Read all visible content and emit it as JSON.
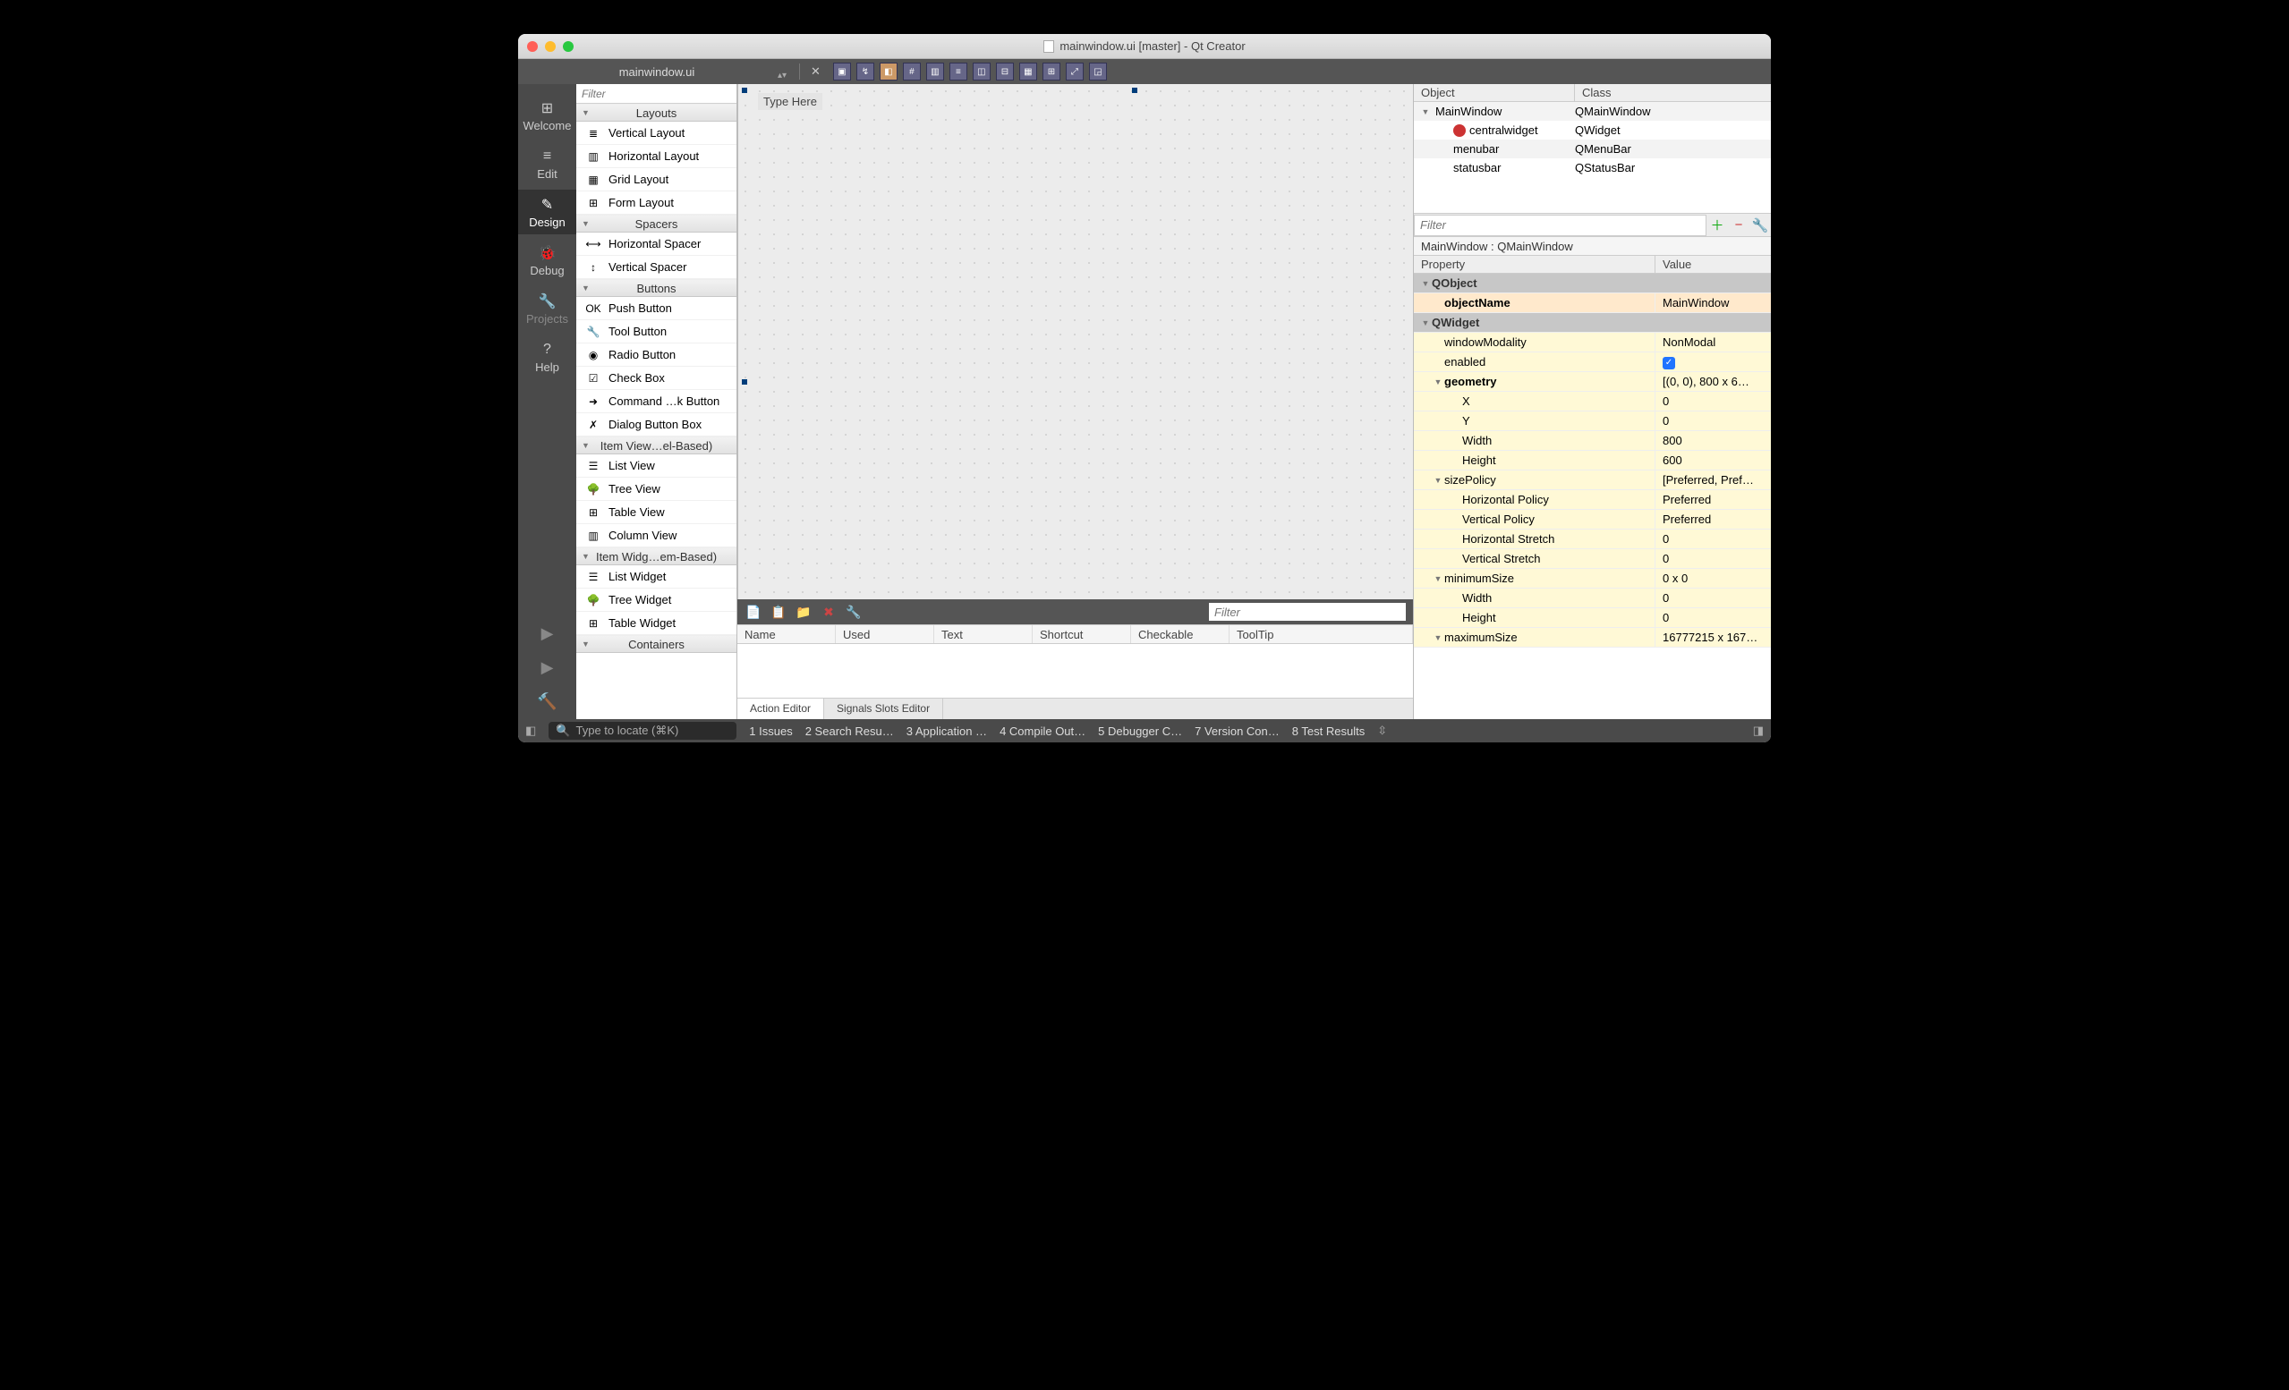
{
  "window": {
    "title": "mainwindow.ui [master] - Qt Creator"
  },
  "subbar": {
    "file": "mainwindow.ui"
  },
  "leftnav": {
    "items": [
      {
        "label": "Welcome",
        "icon": "⊞"
      },
      {
        "label": "Edit",
        "icon": "≡"
      },
      {
        "label": "Design",
        "icon": "✎",
        "active": true
      },
      {
        "label": "Debug",
        "icon": "🐞"
      },
      {
        "label": "Projects",
        "icon": "🔧",
        "dim": true
      },
      {
        "label": "Help",
        "icon": "?"
      }
    ]
  },
  "widgetbox": {
    "filter_placeholder": "Filter",
    "groups": [
      {
        "title": "Layouts",
        "items": [
          {
            "label": "Vertical Layout"
          },
          {
            "label": "Horizontal Layout"
          },
          {
            "label": "Grid Layout"
          },
          {
            "label": "Form Layout"
          }
        ]
      },
      {
        "title": "Spacers",
        "items": [
          {
            "label": "Horizontal Spacer"
          },
          {
            "label": "Vertical Spacer"
          }
        ]
      },
      {
        "title": "Buttons",
        "items": [
          {
            "label": "Push Button"
          },
          {
            "label": "Tool Button"
          },
          {
            "label": "Radio Button"
          },
          {
            "label": "Check Box"
          },
          {
            "label": "Command …k Button"
          },
          {
            "label": "Dialog Button Box"
          }
        ]
      },
      {
        "title": "Item View…el-Based)",
        "items": [
          {
            "label": "List View"
          },
          {
            "label": "Tree View"
          },
          {
            "label": "Table View"
          },
          {
            "label": "Column View"
          }
        ]
      },
      {
        "title": "Item Widg…em-Based)",
        "items": [
          {
            "label": "List Widget"
          },
          {
            "label": "Tree Widget"
          },
          {
            "label": "Table Widget"
          }
        ]
      },
      {
        "title": "Containers",
        "items": []
      }
    ]
  },
  "canvas": {
    "typehere": "Type Here"
  },
  "action_editor": {
    "filter_placeholder": "Filter",
    "cols": {
      "name": "Name",
      "used": "Used",
      "text": "Text",
      "shortcut": "Shortcut",
      "checkable": "Checkable",
      "tooltip": "ToolTip"
    },
    "tabs": {
      "action": "Action Editor",
      "signals": "Signals  Slots Editor"
    }
  },
  "object_inspector": {
    "head": {
      "object": "Object",
      "class": "Class"
    },
    "rows": [
      {
        "name": "MainWindow",
        "class": "QMainWindow",
        "indent": 0,
        "expand": true
      },
      {
        "name": "centralwidget",
        "class": "QWidget",
        "indent": 1,
        "badge": true
      },
      {
        "name": "menubar",
        "class": "QMenuBar",
        "indent": 1
      },
      {
        "name": "statusbar",
        "class": "QStatusBar",
        "indent": 1
      }
    ]
  },
  "properties": {
    "filter_placeholder": "Filter",
    "title": "MainWindow : QMainWindow",
    "head": {
      "prop": "Property",
      "val": "Value"
    },
    "rows": [
      {
        "type": "section",
        "label": "QObject"
      },
      {
        "type": "prop",
        "label": "objectName",
        "value": "MainWindow",
        "bold": true,
        "cls": "or"
      },
      {
        "type": "section",
        "label": "QWidget"
      },
      {
        "type": "prop",
        "label": "windowModality",
        "value": "NonModal",
        "cls": "yl"
      },
      {
        "type": "prop",
        "label": "enabled",
        "value": "__check__",
        "cls": "yl"
      },
      {
        "type": "group",
        "label": "geometry",
        "value": "[(0, 0), 800 x 6…",
        "cls": "yl",
        "bold": true
      },
      {
        "type": "sub",
        "label": "X",
        "value": "0",
        "cls": "yl"
      },
      {
        "type": "sub",
        "label": "Y",
        "value": "0",
        "cls": "yl"
      },
      {
        "type": "sub",
        "label": "Width",
        "value": "800",
        "cls": "yl"
      },
      {
        "type": "sub",
        "label": "Height",
        "value": "600",
        "cls": "yl"
      },
      {
        "type": "group",
        "label": "sizePolicy",
        "value": "[Preferred, Pref…",
        "cls": "yl"
      },
      {
        "type": "sub",
        "label": "Horizontal Policy",
        "value": "Preferred",
        "cls": "yl"
      },
      {
        "type": "sub",
        "label": "Vertical Policy",
        "value": "Preferred",
        "cls": "yl"
      },
      {
        "type": "sub",
        "label": "Horizontal Stretch",
        "value": "0",
        "cls": "yl"
      },
      {
        "type": "sub",
        "label": "Vertical Stretch",
        "value": "0",
        "cls": "yl"
      },
      {
        "type": "group",
        "label": "minimumSize",
        "value": "0 x 0",
        "cls": "yl"
      },
      {
        "type": "sub",
        "label": "Width",
        "value": "0",
        "cls": "yl"
      },
      {
        "type": "sub",
        "label": "Height",
        "value": "0",
        "cls": "yl"
      },
      {
        "type": "group",
        "label": "maximumSize",
        "value": "16777215 x 167…",
        "cls": "yl"
      }
    ]
  },
  "statusbar": {
    "locate_placeholder": "Type to locate (⌘K)",
    "items": [
      {
        "n": "1",
        "label": "Issues"
      },
      {
        "n": "2",
        "label": "Search Resu…"
      },
      {
        "n": "3",
        "label": "Application …"
      },
      {
        "n": "4",
        "label": "Compile Out…"
      },
      {
        "n": "5",
        "label": "Debugger C…"
      },
      {
        "n": "7",
        "label": "Version Con…"
      },
      {
        "n": "8",
        "label": "Test Results"
      }
    ]
  }
}
